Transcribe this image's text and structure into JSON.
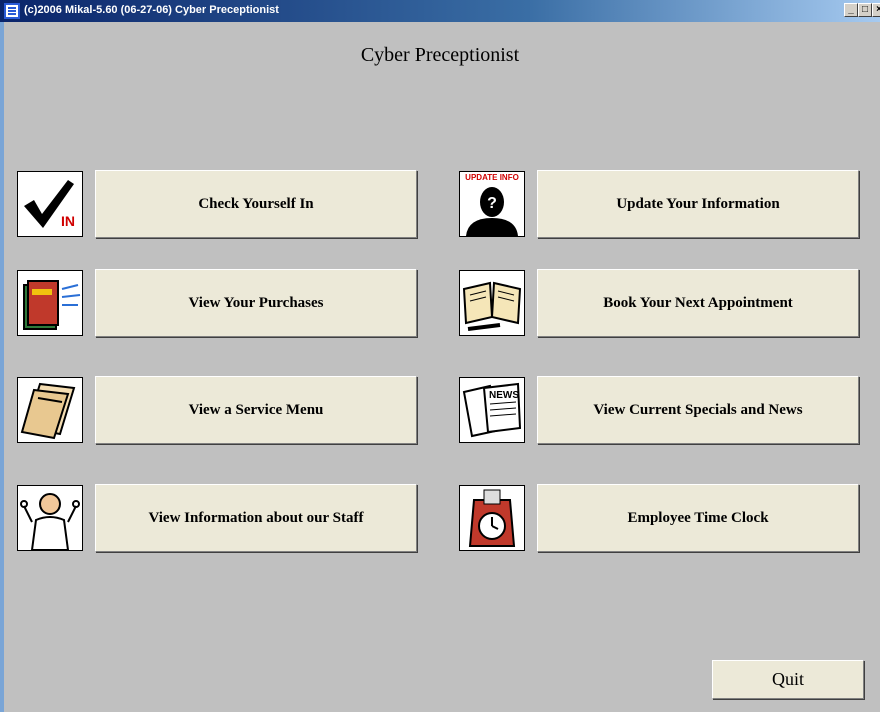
{
  "window": {
    "title": "(c)2006 Mikal-5.60 (06-27-06) Cyber Preceptionist",
    "icon": "app-icon",
    "controls": {
      "minimize": "_",
      "maximize": "□",
      "close": "×"
    }
  },
  "app": {
    "title": "Cyber Preceptionist"
  },
  "menu": {
    "check_in": {
      "label": "Check Yourself In",
      "icon": "checkmark-in-icon",
      "icon_text": "IN"
    },
    "update_info": {
      "label": "Update Your Information",
      "icon": "update-info-person-icon",
      "icon_text": "UPDATE INFO"
    },
    "purchases": {
      "label": "View Your Purchases",
      "icon": "book-purchases-icon"
    },
    "appointment": {
      "label": "Book Your Next Appointment",
      "icon": "open-book-pen-icon"
    },
    "service_menu": {
      "label": "View a Service Menu",
      "icon": "service-menu-icon"
    },
    "specials": {
      "label": "View Current Specials and News",
      "icon": "newspaper-icon",
      "icon_text": "NEWS"
    },
    "staff": {
      "label": "View Information about our Staff",
      "icon": "staff-barber-icon"
    },
    "time_clock": {
      "label": "Employee Time Clock",
      "icon": "time-clock-icon"
    }
  },
  "quit": {
    "label": "Quit"
  },
  "colors": {
    "background": "#c0c0c0",
    "button": "#ece9d8",
    "titlebar": "#0a246a",
    "accent_red": "#d00000"
  }
}
